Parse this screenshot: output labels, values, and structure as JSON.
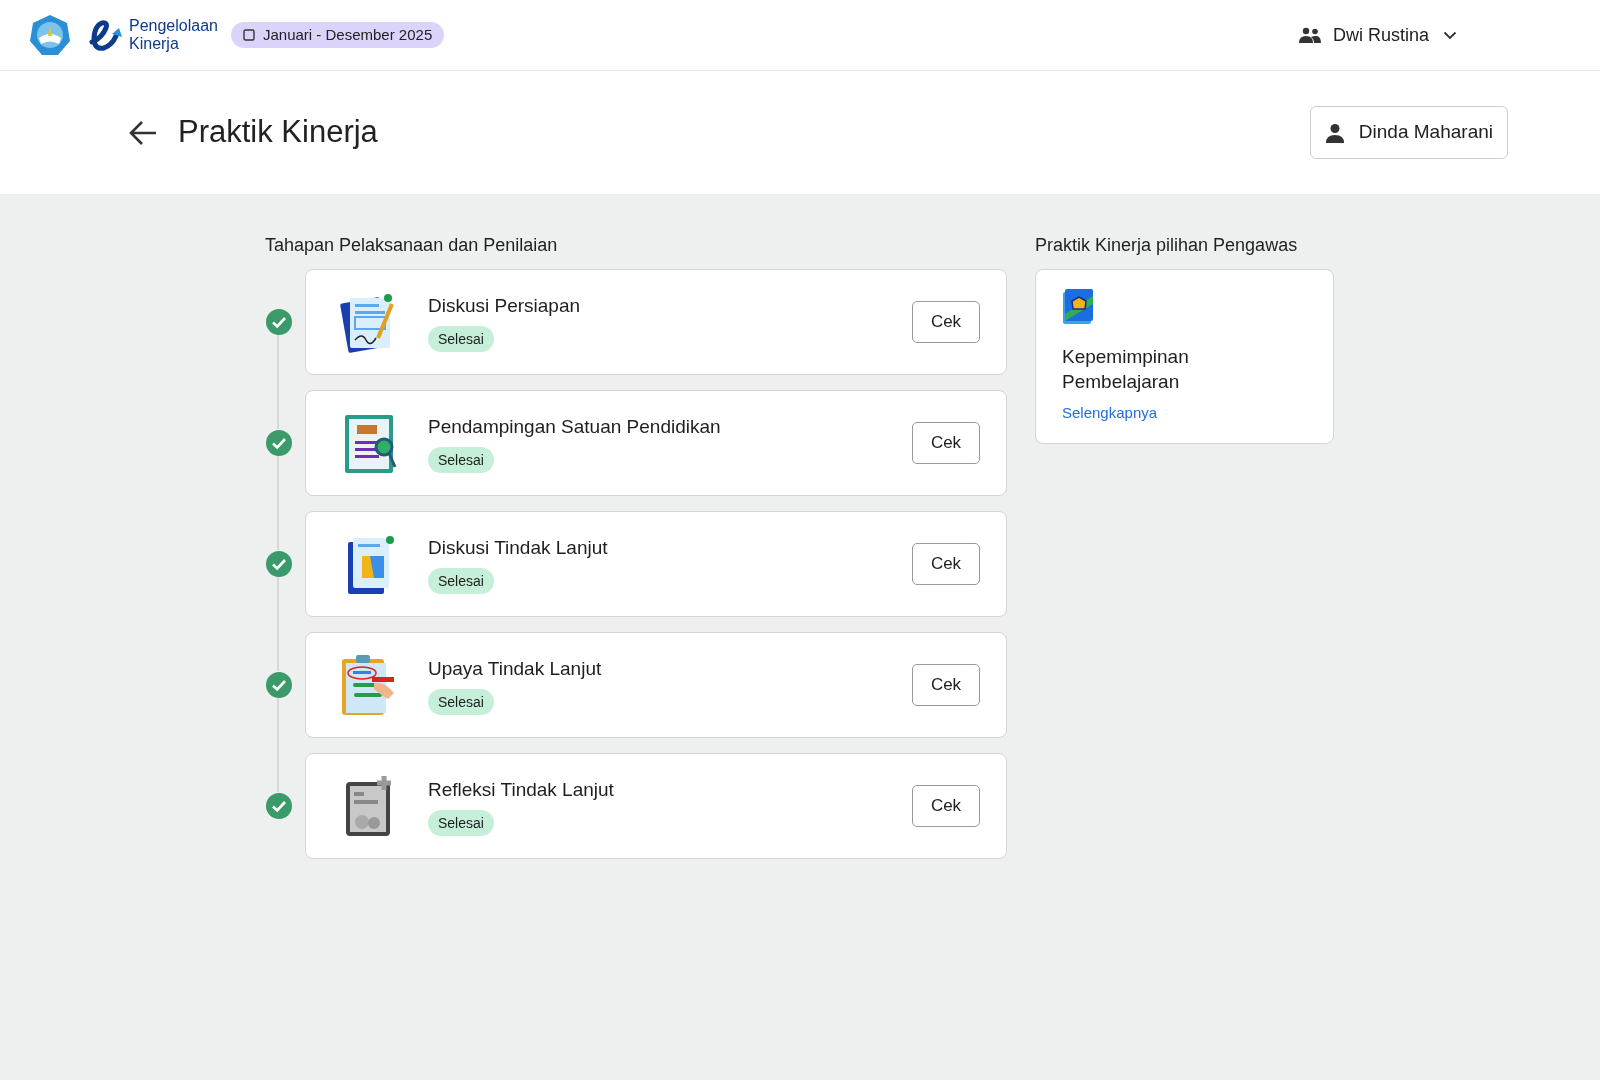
{
  "header": {
    "app_name_line1": "Pengelolaan",
    "app_name_line2": "Kinerja",
    "period": "Januari - Desember 2025",
    "user": "Dwi Rustina"
  },
  "page": {
    "title": "Praktik Kinerja",
    "person": "Dinda Maharani"
  },
  "steps_section": {
    "heading": "Tahapan Pelaksanaan dan Penilaian",
    "steps": [
      {
        "title": "Diskusi Persiapan",
        "status": "Selesai",
        "done": true,
        "button": "Cek"
      },
      {
        "title": "Pendampingan Satuan Pendidikan",
        "status": "Selesai",
        "done": true,
        "button": "Cek"
      },
      {
        "title": "Diskusi Tindak Lanjut",
        "status": "Selesai",
        "done": true,
        "button": "Cek"
      },
      {
        "title": "Upaya Tindak Lanjut",
        "status": "Selesai",
        "done": true,
        "button": "Cek"
      },
      {
        "title": "Refleksi Tindak Lanjut",
        "status": "Selesai",
        "done": true,
        "button": "Cek"
      }
    ]
  },
  "choice_section": {
    "heading": "Praktik Kinerja pilihan Pengawas",
    "card": {
      "title": "Kepemimpinan Pembelajaran",
      "link": "Selengkapnya"
    }
  }
}
